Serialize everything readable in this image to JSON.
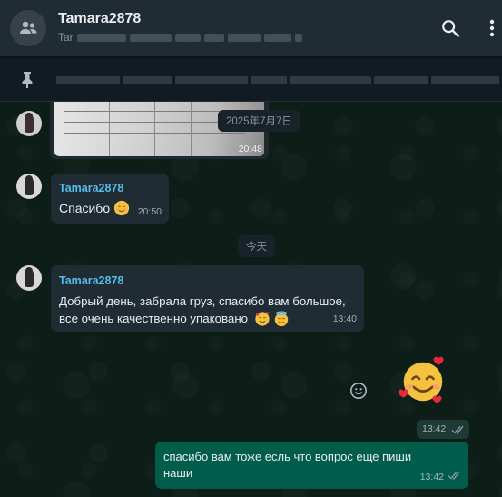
{
  "header": {
    "title": "Tamara2878",
    "subtitle_prefix": "Tar"
  },
  "pinned": {
    "preview": ""
  },
  "messages": {
    "image": {
      "time": "20:48"
    },
    "date1": "2025年7月7日",
    "msg1": {
      "sender": "Tamara2878",
      "text": "Спасибо",
      "time": "20:50"
    },
    "date2": "今天",
    "msg2": {
      "sender": "Tamara2878",
      "line1": "Добрый день, забрала груз, спасибо вам большое,",
      "line2": "все очень качественно упаковано",
      "time": "13:40"
    },
    "sticker": {
      "time": "13:42"
    },
    "msg3": {
      "line1": "спасибо вам тоже  есль что вопрос  еще пиши",
      "line2": "наши",
      "time": "13:42"
    }
  },
  "colors": {
    "header_bg": "#202c33",
    "incoming_bubble": "#202c33",
    "outgoing_bubble": "#005c4b",
    "sender_name": "#53bdeb",
    "read_ticks": "#8696a0"
  },
  "icons": [
    "group-avatar-icon",
    "search-icon",
    "menu-dots-icon",
    "pin-icon",
    "emoji-picker-icon",
    "double-check-icon"
  ]
}
